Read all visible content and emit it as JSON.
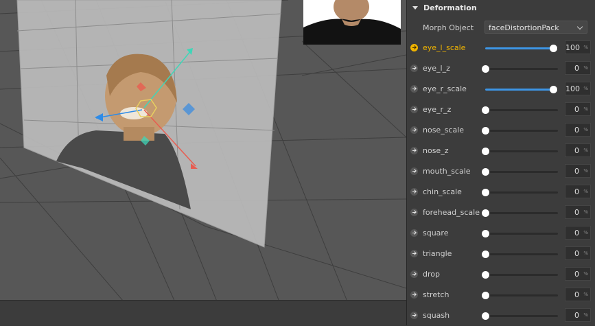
{
  "viewport": {
    "background_color": "#575757",
    "gizmo_colors": {
      "x_axis": "#e85c50",
      "y_axis": "#3fd6b8",
      "z_axis": "#2d8be8",
      "center": "#e8d060",
      "plane": "#4a90d9"
    }
  },
  "preview": {
    "image": "webcam-preview-person"
  },
  "panel": {
    "section_title": "Deformation",
    "morph_object": {
      "label": "Morph Object",
      "value": "faceDistortionPack"
    },
    "params": [
      {
        "label": "eye_l_scale",
        "value": "100",
        "level": 1.0,
        "active": true
      },
      {
        "label": "eye_l_z",
        "value": "0",
        "level": 0,
        "active": false
      },
      {
        "label": "eye_r_scale",
        "value": "100",
        "level": 1.0,
        "active": false
      },
      {
        "label": "eye_r_z",
        "value": "0",
        "level": 0,
        "active": false
      },
      {
        "label": "nose_scale",
        "value": "0",
        "level": 0,
        "active": false
      },
      {
        "label": "nose_z",
        "value": "0",
        "level": 0,
        "active": false
      },
      {
        "label": "mouth_scale",
        "value": "0",
        "level": 0,
        "active": false
      },
      {
        "label": "chin_scale",
        "value": "0",
        "level": 0,
        "active": false
      },
      {
        "label": "forehead_scale",
        "value": "0",
        "level": 0,
        "active": false
      },
      {
        "label": "square",
        "value": "0",
        "level": 0,
        "active": false
      },
      {
        "label": "triangle",
        "value": "0",
        "level": 0,
        "active": false
      },
      {
        "label": "drop",
        "value": "0",
        "level": 0,
        "active": false
      },
      {
        "label": "stretch",
        "value": "0",
        "level": 0,
        "active": false
      },
      {
        "label": "squash",
        "value": "0",
        "level": 0,
        "active": false
      }
    ],
    "unit": "%",
    "accent_color": "#3d96e6",
    "active_color": "#f0b400"
  }
}
